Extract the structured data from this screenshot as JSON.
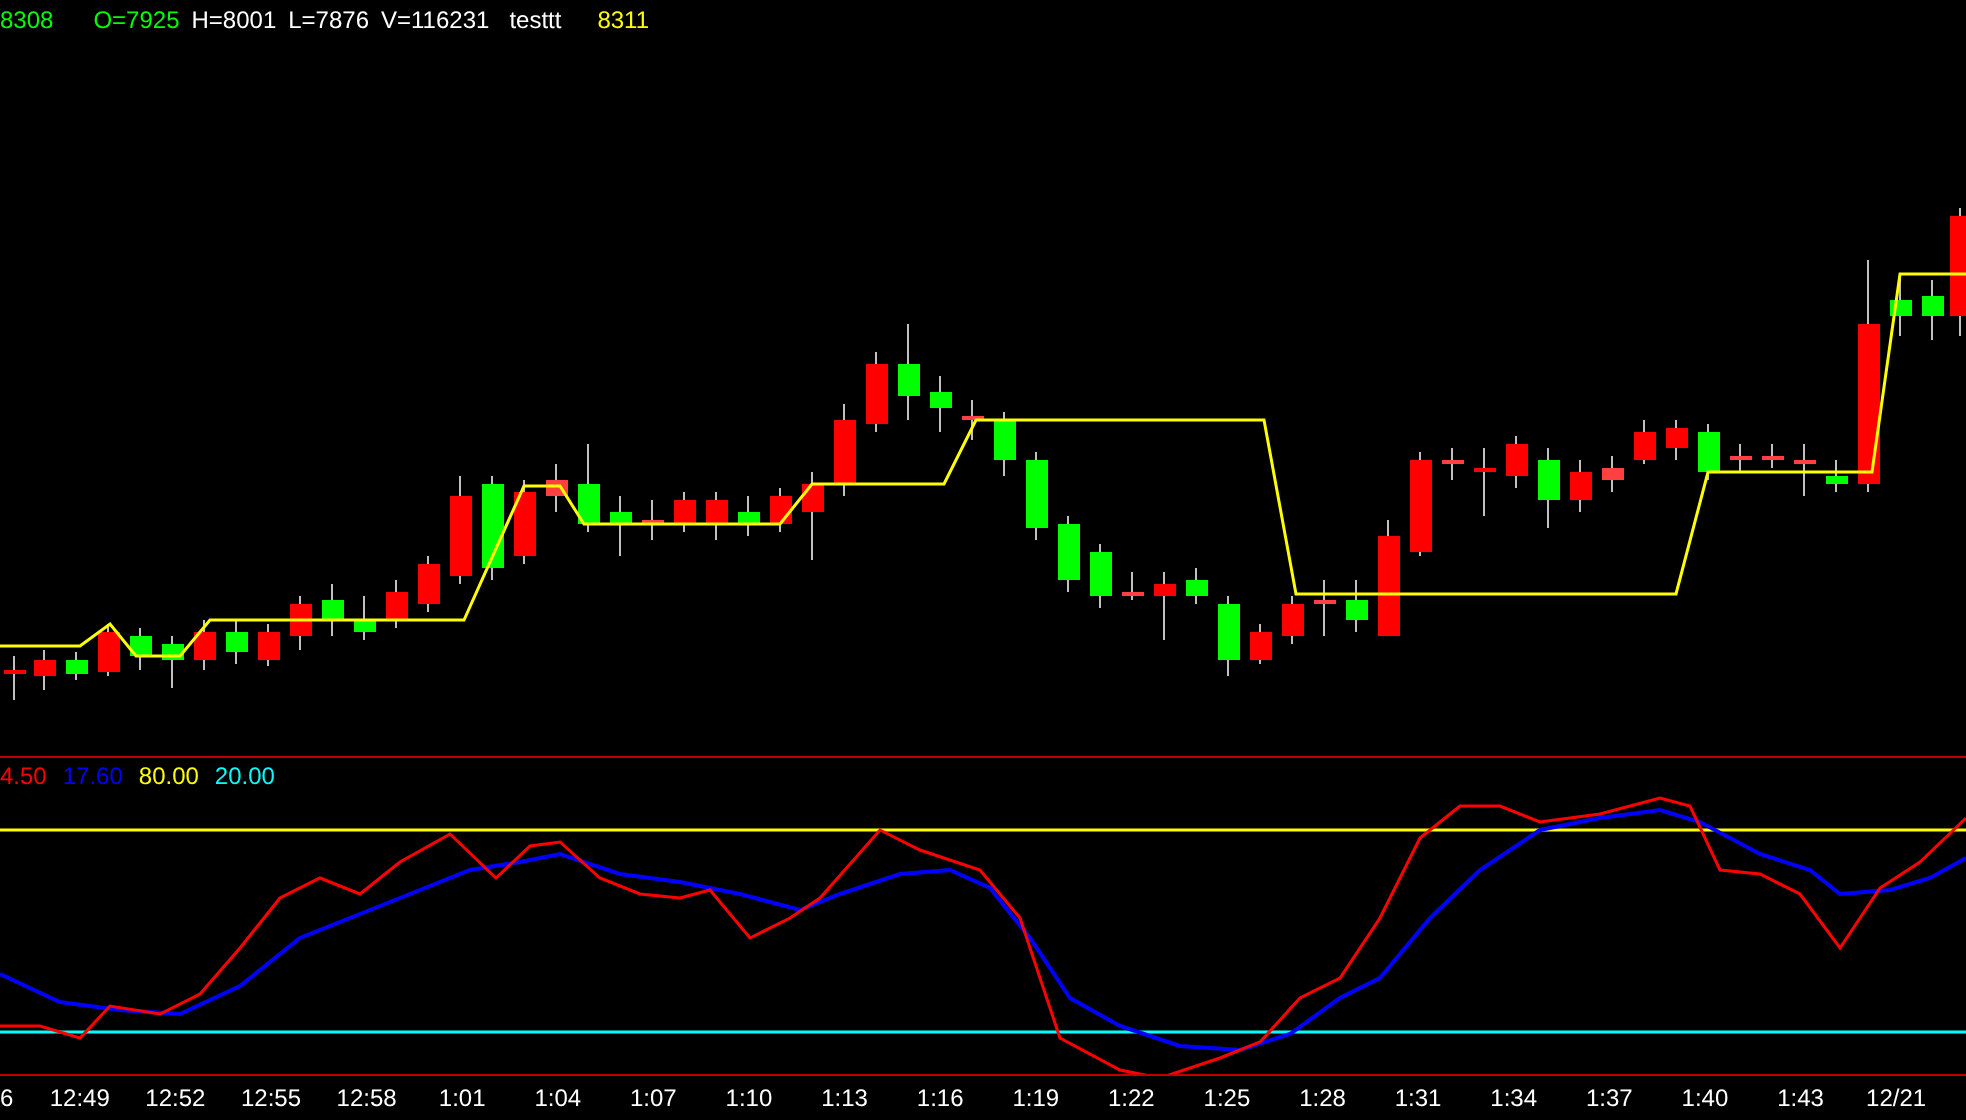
{
  "header": [
    {
      "text": "8308",
      "color": "#00ff00"
    },
    {
      "text": "O=7925",
      "color": "#00ff00"
    },
    {
      "text": "H=8001",
      "color": "#ffffff"
    },
    {
      "text": "L=7876",
      "color": "#ffffff"
    },
    {
      "text": "V=116231",
      "color": "#ffffff"
    },
    {
      "text": "testtt",
      "color": "#ffffff"
    },
    {
      "text": "8311",
      "color": "#ffff00"
    }
  ],
  "oscillator_legend": [
    {
      "text": "4.50",
      "color": "#ff0000"
    },
    {
      "text": "17.60",
      "color": "#0000ff"
    },
    {
      "text": "80.00",
      "color": "#ffff00"
    },
    {
      "text": "20.00",
      "color": "#00ffff"
    }
  ],
  "time_axis": [
    "6",
    "12:49",
    "12:52",
    "12:55",
    "12:58",
    "1:01",
    "1:04",
    "1:07",
    "1:10",
    "1:13",
    "1:16",
    "1:19",
    "1:22",
    "1:25",
    "1:28",
    "1:31",
    "1:34",
    "1:37",
    "1:40",
    "1:43",
    "12/21"
  ]
}
